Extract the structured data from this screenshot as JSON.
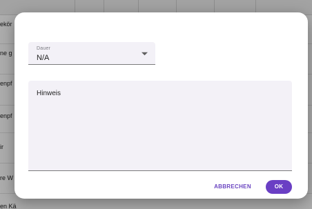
{
  "background": {
    "rows": [
      {
        "fragment": "ekör"
      },
      {
        "fragment": "ne g"
      },
      {
        "fragment": "enpf"
      },
      {
        "fragment": "enpf"
      },
      {
        "fragment": "ir"
      },
      {
        "fragment": "re W"
      },
      {
        "fragment": "en Kä"
      }
    ]
  },
  "dialog": {
    "duration": {
      "label": "Dauer",
      "value": "N/A",
      "icon": "dropdown-arrow-icon"
    },
    "note": {
      "label": "Hinweis"
    },
    "actions": {
      "cancel_label": "ABBRECHEN",
      "ok_label": "OK"
    }
  },
  "colors": {
    "accent": "#6a3fc4",
    "field_background": "#f3f1f7"
  }
}
